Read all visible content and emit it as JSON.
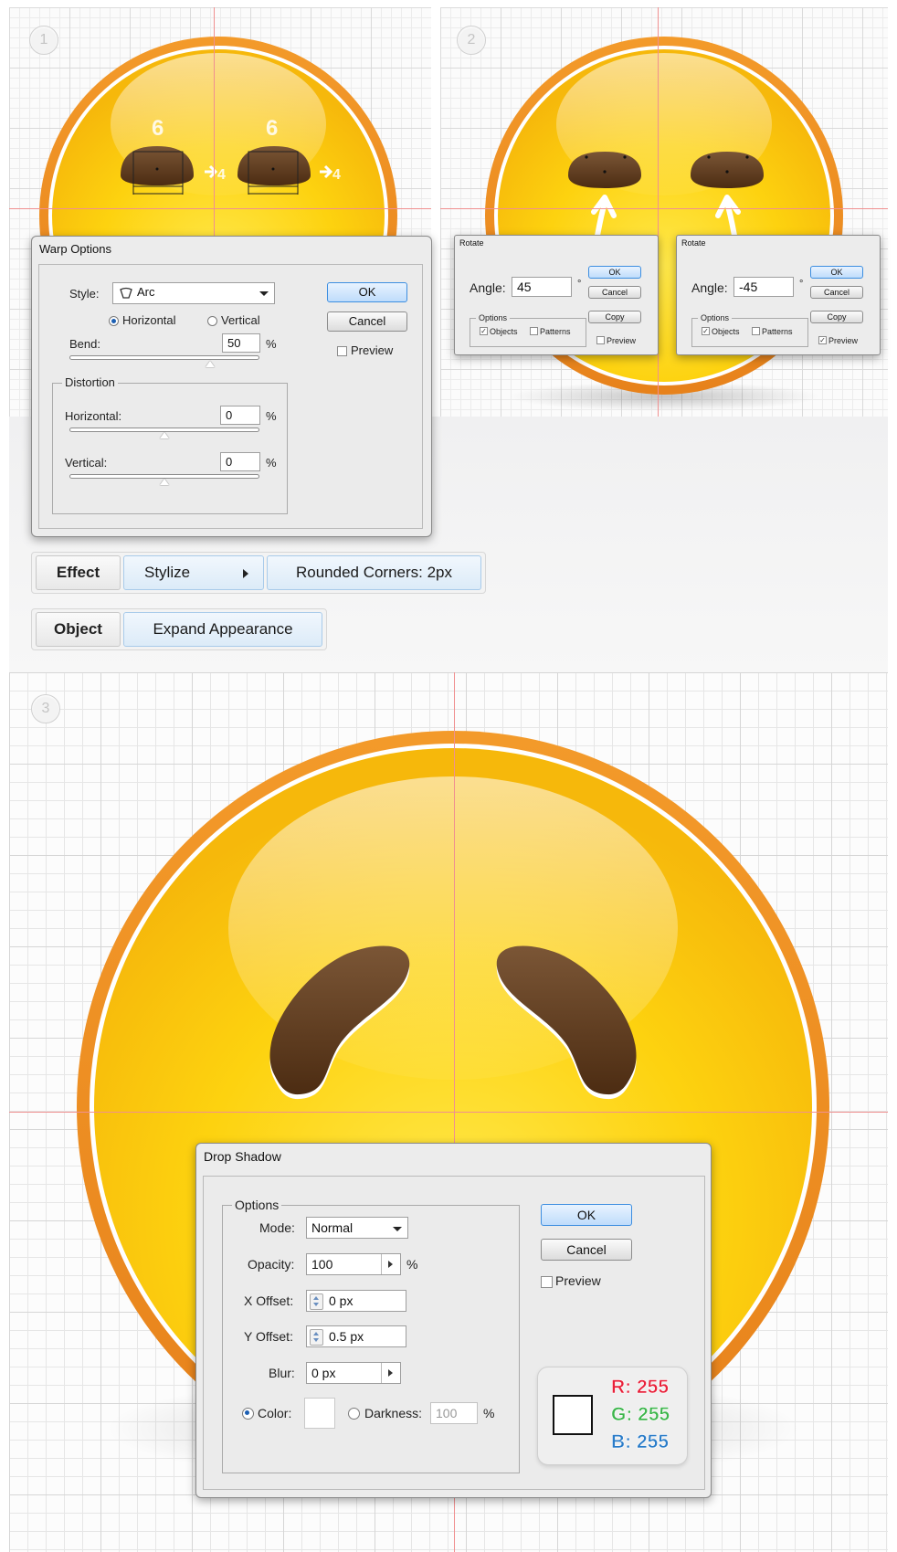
{
  "steps": [
    "1",
    "2",
    "3"
  ],
  "warp_options": {
    "title": "Warp Options",
    "style_label": "Style:",
    "style_value": "Arc",
    "horizontal_label": "Horizontal",
    "vertical_label": "Vertical",
    "bend_label": "Bend:",
    "bend_value": "50",
    "percent": "%",
    "distortion_label": "Distortion",
    "dist_horizontal_label": "Horizontal:",
    "dist_horizontal_value": "0",
    "dist_vertical_label": "Vertical:",
    "dist_vertical_value": "0",
    "ok": "OK",
    "cancel": "Cancel",
    "preview": "Preview"
  },
  "rotate_left": {
    "title": "Rotate",
    "angle_label": "Angle:",
    "angle_value": "45",
    "degree": "°",
    "options_label": "Options",
    "objects_label": "Objects",
    "patterns_label": "Patterns",
    "ok": "OK",
    "cancel": "Cancel",
    "copy": "Copy",
    "preview": "Preview"
  },
  "rotate_right": {
    "title": "Rotate",
    "angle_label": "Angle:",
    "angle_value": "-45",
    "degree": "°",
    "options_label": "Options",
    "objects_label": "Objects",
    "patterns_label": "Patterns",
    "ok": "OK",
    "cancel": "Cancel",
    "copy": "Copy",
    "preview": "Preview"
  },
  "annotations": {
    "eye_height_left": "6",
    "eye_height_right": "6",
    "eye_width_left": "4",
    "eye_width_right": "4"
  },
  "menu_path_1": {
    "item1": "Effect",
    "item2": "Stylize",
    "item3": "Rounded Corners: 2px"
  },
  "menu_path_2": {
    "item1": "Object",
    "item2": "Expand Appearance"
  },
  "drop_shadow": {
    "title": "Drop Shadow",
    "options_label": "Options",
    "mode_label": "Mode:",
    "mode_value": "Normal",
    "opacity_label": "Opacity:",
    "opacity_value": "100",
    "percent": "%",
    "x_offset_label": "X Offset:",
    "x_offset_value": "0 px",
    "y_offset_label": "Y Offset:",
    "y_offset_value": "0.5 px",
    "blur_label": "Blur:",
    "blur_value": "0 px",
    "color_label": "Color:",
    "darkness_label": "Darkness:",
    "darkness_value": "100",
    "ok": "OK",
    "cancel": "Cancel",
    "preview": "Preview",
    "swatch_color": "#FFFFFF",
    "r_label": "R: 255",
    "g_label": "G: 255",
    "b_label": "B: 255"
  },
  "colors": {
    "face_yellow": "#FDD20F",
    "face_orange_rim": "#EE8F22",
    "eye_brown": "#5E3A1A",
    "guide_red": "#F09090",
    "r_red": "#E8213A",
    "g_green": "#3BB54A",
    "b_blue": "#2A7CC8"
  }
}
